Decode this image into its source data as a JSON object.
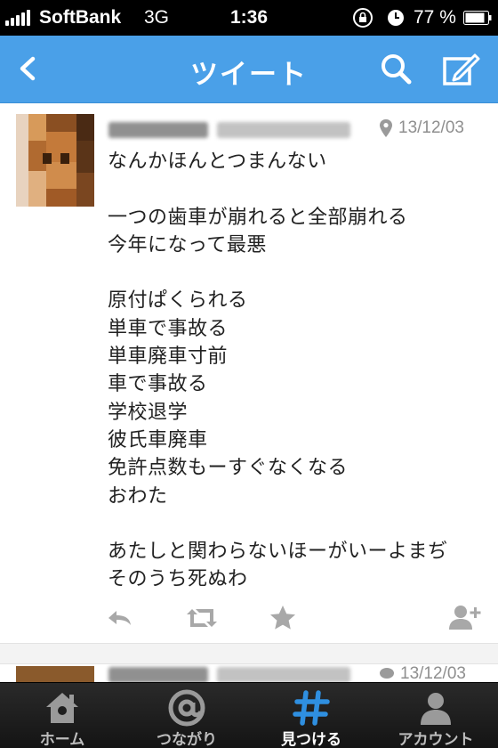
{
  "status_bar": {
    "carrier": "SoftBank",
    "network": "3G",
    "time": "1:36",
    "battery": "77 %"
  },
  "nav": {
    "title": "ツイート",
    "back_icon": "chevron-left-icon",
    "search_icon": "search-icon",
    "compose_icon": "compose-icon"
  },
  "tweet": {
    "date": "13/12/03",
    "text": "なんかほんとつまんない\n\n一つの歯車が崩れると全部崩れる\n今年になって最悪\n\n原付ぱくられる\n単車で事故る\n単車廃車寸前\n車で事故る\n学校退学\n彼氏車廃車\n免許点数もーすぐなくなる\nおわた\n\nあたしと関わらないほーがいーよまぢ\nそのうち死ぬわ",
    "actions": [
      "reply-icon",
      "retweet-icon",
      "favorite-icon",
      "follow-icon"
    ]
  },
  "next_tweet": {
    "date": "13/12/03"
  },
  "tab_bar": {
    "active": "find",
    "tabs": [
      {
        "id": "home",
        "label": "ホーム",
        "icon": "home-icon"
      },
      {
        "id": "connect",
        "label": "つながり",
        "icon": "at-icon"
      },
      {
        "id": "find",
        "label": "見つける",
        "icon": "hashtag-icon"
      },
      {
        "id": "account",
        "label": "アカウント",
        "icon": "account-icon"
      }
    ]
  },
  "colors": {
    "nav_blue": "#4aa0e8",
    "tab_active": "#2f8fe0",
    "icon_gray": "#9a9a9a"
  }
}
